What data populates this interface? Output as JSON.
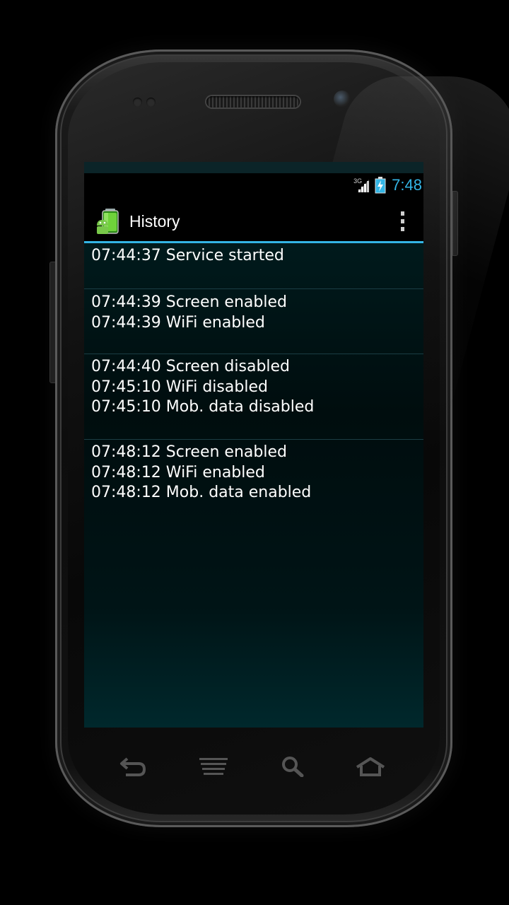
{
  "status_bar": {
    "network_type": "3G",
    "time": "7:48",
    "signal_icon": "signal-icon",
    "battery_icon": "battery-charging-icon"
  },
  "action_bar": {
    "title": "History",
    "app_icon": "battery-android-icon",
    "overflow_icon": "overflow-menu-icon"
  },
  "history": [
    {
      "lines": [
        "07:44:37 Service started"
      ]
    },
    {
      "lines": [
        "07:44:39 Screen enabled",
        "07:44:39 WiFi enabled"
      ]
    },
    {
      "lines": [
        "07:44:40 Screen disabled",
        "07:45:10 WiFi disabled",
        "07:45:10 Mob. data disabled"
      ]
    },
    {
      "lines": [
        "07:48:12 Screen enabled",
        "07:48:12 WiFi enabled",
        "07:48:12 Mob. data enabled"
      ]
    }
  ],
  "nav_bar": {
    "back_icon": "back-icon",
    "menu_icon": "menu-icon",
    "search_icon": "search-icon",
    "home_icon": "home-icon"
  },
  "colors": {
    "accent": "#33b5e5",
    "text": "#ffffff",
    "list_bg": "#001416"
  }
}
